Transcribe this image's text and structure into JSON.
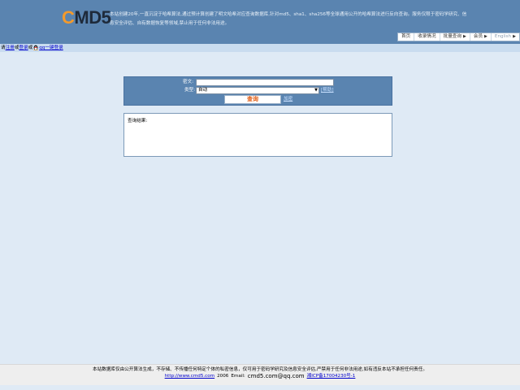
{
  "header": {
    "logo_first": "C",
    "logo_rest": "MD5",
    "intro": "本站创建20年,一直沉淀于哈希算法,通过预计算创建了明文哈希对应查询数据库,针对md5、sha1、sha256等全球通用公开的哈希算法进行反向查询。服务仅限于密码学研究、信息安全评估、自有数据恢复等领域,禁止用于任何非法用途。",
    "nav": [
      {
        "label": "首页",
        "has_menu": false
      },
      {
        "label": "收录情况",
        "has_menu": false
      },
      {
        "label": "批量查询",
        "has_menu": true
      },
      {
        "label": "会员",
        "has_menu": true
      },
      {
        "label": "English",
        "has_menu": true
      }
    ],
    "menu_arrow": "▶"
  },
  "loginbar": {
    "prefix": "请",
    "register": "注册",
    "or1": "或",
    "login": "登录",
    "or2": "或",
    "qq_login": "qq一键登录"
  },
  "search": {
    "cipher_label": "密文:",
    "cipher_value": "",
    "type_label": "类型:",
    "type_value": "自动",
    "help_link": "[帮助]",
    "query_button": "查询",
    "encrypt_link": "加密"
  },
  "result": {
    "label": "查询结果:"
  },
  "footer": {
    "disclaimer": "本站数据库仅由公开算法生成，不存储、不传播任何特定个体的私密信息，仅可用于密码学研究及信息安全评估,严禁用于任何非法用途,如有违反本站不承担任何责任。",
    "site_url": "http://www.cmd5.com",
    "year": "2006",
    "email_label": "Email:",
    "email": "cmd5.com@qq.com",
    "icp": "湘ICP备17004230号-1"
  },
  "colors": {
    "header_bg": "#5a84b0",
    "page_bg": "#dfeaf5",
    "logo_accent": "#f39a2c",
    "query_text": "#e05a10"
  }
}
